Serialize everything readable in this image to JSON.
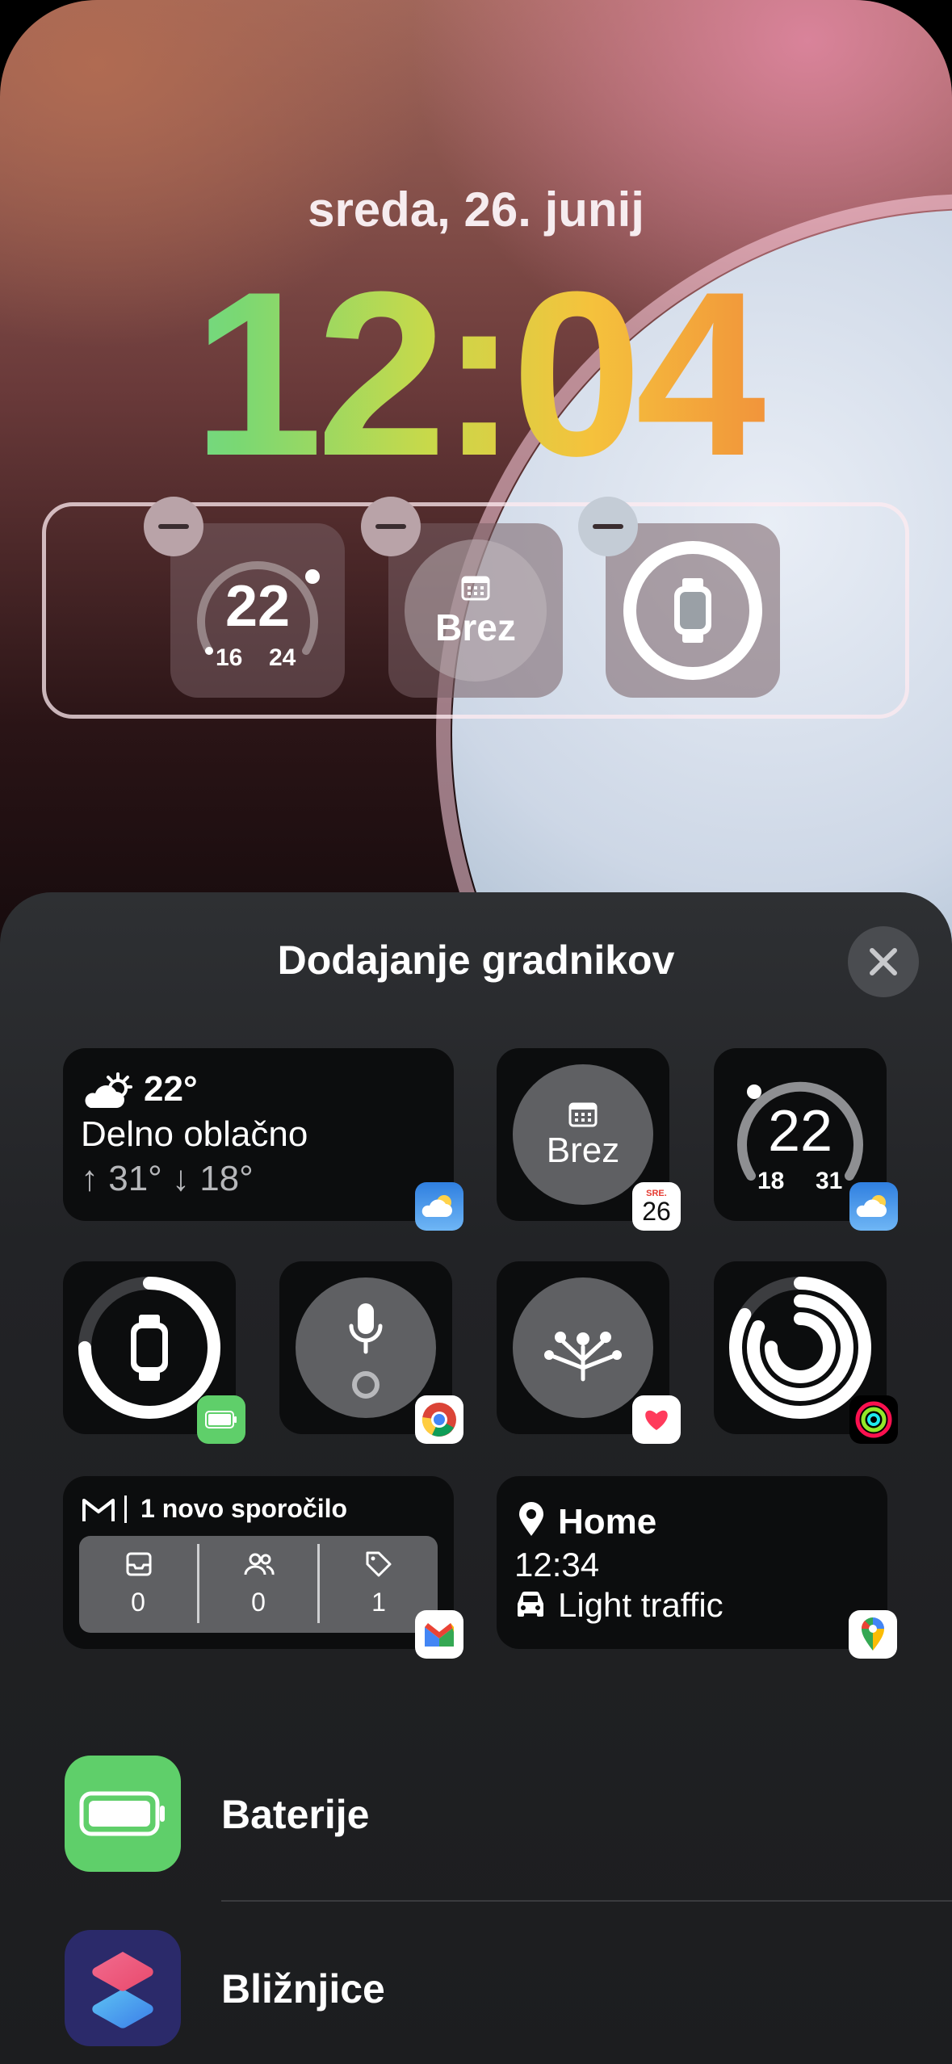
{
  "lockscreen": {
    "date": "sreda, 26. junij",
    "time": "12:04",
    "widgets": {
      "weather": {
        "temp": "22",
        "low": "16",
        "high": "24",
        "level": 0.75
      },
      "calendar": {
        "label": "Brez"
      },
      "watch": {
        "level": 1.0
      }
    }
  },
  "sheet": {
    "title": "Dodajanje gradnikov",
    "weather_large": {
      "temp": "22°",
      "condition": "Delno oblačno",
      "range": "↑ 31° ↓ 18°"
    },
    "calendar_tile": {
      "label": "Brez",
      "badge_day": "SRE.",
      "badge_date": "26"
    },
    "weather_gauge": {
      "temp": "22",
      "low": "18",
      "high": "31",
      "level": 0.1
    },
    "battery_ring": {
      "level": 0.75
    },
    "gmail": {
      "title": "1 novo sporočilo",
      "counts": [
        "0",
        "0",
        "1"
      ]
    },
    "maps": {
      "place": "Home",
      "time": "12:34",
      "traffic": "Light traffic"
    },
    "apps": [
      {
        "name": "Baterije",
        "color": "#5fcf6a"
      },
      {
        "name": "Bližnjice",
        "color": "#2b2a6a"
      }
    ]
  }
}
